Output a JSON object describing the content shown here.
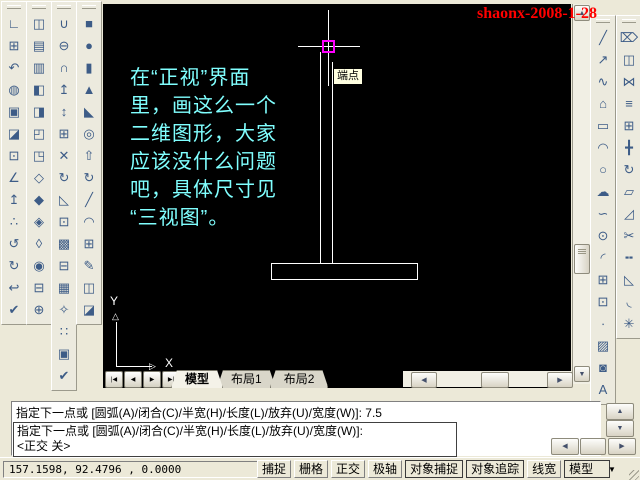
{
  "annotation": {
    "text": "shaonx-2008-1-28",
    "color": "#ff0000"
  },
  "colors": {
    "canvas_bg": "#000000",
    "note_text": "#80ffff",
    "snap_marker": "#ff00ff",
    "tooltip_bg": "#ffffe1",
    "annotation_text": "#ff0000"
  },
  "canvas": {
    "note_lines": [
      "在“正视”界面",
      "里，画这么一个",
      "二维图形，大家",
      "应该没什么问题",
      "吧，具体尺寸见",
      "“三视图”。"
    ],
    "tooltip": "端点",
    "ucs_x": "X",
    "ucs_y": "Y"
  },
  "toolbars": {
    "columns": [
      {
        "id": "tb-l0",
        "name": "ucs-toolbar",
        "icons": [
          {
            "name": "ucs-icon",
            "glyph": "∟"
          },
          {
            "name": "named-ucs-dialog-icon",
            "glyph": "⊞"
          },
          {
            "name": "ucs-previous-icon",
            "glyph": "↶"
          },
          {
            "name": "world-ucs-icon",
            "glyph": "◍"
          },
          {
            "name": "object-ucs-icon",
            "glyph": "▣"
          },
          {
            "name": "face-ucs-icon",
            "glyph": "◪"
          },
          {
            "name": "view-ucs-icon",
            "glyph": "⊡"
          },
          {
            "name": "origin-ucs-icon",
            "glyph": "∠"
          },
          {
            "name": "z-axis-vector-ucs-icon",
            "glyph": "↥"
          },
          {
            "name": "three-point-ucs-icon",
            "glyph": "∴"
          },
          {
            "name": "x-rotate-ucs-icon",
            "glyph": "↺"
          },
          {
            "name": "y-rotate-ucs-icon",
            "glyph": "↻"
          },
          {
            "name": "z-rotate-ucs-icon",
            "glyph": "↩"
          },
          {
            "name": "apply-ucs-icon",
            "glyph": "✔"
          }
        ]
      },
      {
        "id": "tb-l1",
        "name": "view-toolbar",
        "icons": [
          {
            "name": "named-views-icon",
            "glyph": "◫"
          },
          {
            "name": "top-view-icon",
            "glyph": "▤"
          },
          {
            "name": "bottom-view-icon",
            "glyph": "▥"
          },
          {
            "name": "left-view-icon",
            "glyph": "◧"
          },
          {
            "name": "right-view-icon",
            "glyph": "◨"
          },
          {
            "name": "front-view-icon",
            "glyph": "◰"
          },
          {
            "name": "back-view-icon",
            "glyph": "◳"
          },
          {
            "name": "sw-isometric-view-icon",
            "glyph": "◇"
          },
          {
            "name": "se-isometric-view-icon",
            "glyph": "◆"
          },
          {
            "name": "ne-isometric-view-icon",
            "glyph": "◈"
          },
          {
            "name": "nw-isometric-view-icon",
            "glyph": "◊"
          },
          {
            "name": "camera-icon",
            "glyph": "◉"
          },
          {
            "name": "plan-view-icon",
            "glyph": "⊟"
          },
          {
            "name": "ucs-origin-icon",
            "glyph": "⊕"
          }
        ]
      },
      {
        "id": "tb-l2",
        "name": "solids-editing-toolbar",
        "icons": [
          {
            "name": "union-icon",
            "glyph": "∪"
          },
          {
            "name": "subtract-icon",
            "glyph": "⊖"
          },
          {
            "name": "intersect-icon",
            "glyph": "∩"
          },
          {
            "name": "extrude-faces-icon",
            "glyph": "↥"
          },
          {
            "name": "move-faces-icon",
            "glyph": "↕"
          },
          {
            "name": "offset-faces-icon",
            "glyph": "⊞"
          },
          {
            "name": "delete-faces-icon",
            "glyph": "✕"
          },
          {
            "name": "rotate-faces-icon",
            "glyph": "↻"
          },
          {
            "name": "taper-faces-icon",
            "glyph": "◺"
          },
          {
            "name": "copy-faces-icon",
            "glyph": "⊡"
          },
          {
            "name": "color-faces-icon",
            "glyph": "▩"
          },
          {
            "name": "copy-edges-icon",
            "glyph": "⊟"
          },
          {
            "name": "color-edges-icon",
            "glyph": "▦"
          },
          {
            "name": "clean-icon",
            "glyph": "✧"
          },
          {
            "name": "separate-icon",
            "glyph": "∷"
          },
          {
            "name": "shell-icon",
            "glyph": "▣"
          },
          {
            "name": "check-icon",
            "glyph": "✔"
          }
        ]
      },
      {
        "id": "tb-l3",
        "name": "solids-toolbar",
        "icons": [
          {
            "name": "box-icon",
            "glyph": "■"
          },
          {
            "name": "sphere-icon",
            "glyph": "●"
          },
          {
            "name": "cylinder-icon",
            "glyph": "▮"
          },
          {
            "name": "cone-icon",
            "glyph": "▲"
          },
          {
            "name": "wedge-icon",
            "glyph": "◣"
          },
          {
            "name": "torus-icon",
            "glyph": "◎"
          },
          {
            "name": "extrude-icon",
            "glyph": "⇧"
          },
          {
            "name": "revolve-icon",
            "glyph": "↻"
          },
          {
            "name": "slice-icon",
            "glyph": "╱"
          },
          {
            "name": "section-icon",
            "glyph": "◠"
          },
          {
            "name": "interfere-icon",
            "glyph": "⊞"
          },
          {
            "name": "setup-drawing-icon",
            "glyph": "✎"
          },
          {
            "name": "setup-view-icon",
            "glyph": "◫"
          },
          {
            "name": "setup-profile-icon",
            "glyph": "◪"
          }
        ]
      },
      {
        "id": "tb-r0",
        "name": "draw-toolbar",
        "icons": [
          {
            "name": "line-icon",
            "glyph": "╱"
          },
          {
            "name": "construction-line-icon",
            "glyph": "↗"
          },
          {
            "name": "polyline-icon",
            "glyph": "∿"
          },
          {
            "name": "polygon-icon",
            "glyph": "⌂"
          },
          {
            "name": "rectangle-icon",
            "glyph": "▭"
          },
          {
            "name": "arc-icon",
            "glyph": "◠"
          },
          {
            "name": "circle-icon",
            "glyph": "○"
          },
          {
            "name": "revcloud-icon",
            "glyph": "☁"
          },
          {
            "name": "spline-icon",
            "glyph": "∽"
          },
          {
            "name": "ellipse-icon",
            "glyph": "⊙"
          },
          {
            "name": "ellipse-arc-icon",
            "glyph": "◜"
          },
          {
            "name": "insert-block-icon",
            "glyph": "⊞"
          },
          {
            "name": "make-block-icon",
            "glyph": "⊡"
          },
          {
            "name": "point-icon",
            "glyph": "∙"
          },
          {
            "name": "hatch-icon",
            "glyph": "▨"
          },
          {
            "name": "region-icon",
            "glyph": "◙"
          },
          {
            "name": "text-icon",
            "glyph": "A"
          }
        ]
      },
      {
        "id": "tb-r1",
        "name": "modify-toolbar",
        "icons": [
          {
            "name": "erase-icon",
            "glyph": "⌦"
          },
          {
            "name": "copy-icon",
            "glyph": "◫"
          },
          {
            "name": "mirror-icon",
            "glyph": "⋈"
          },
          {
            "name": "offset-icon",
            "glyph": "≡"
          },
          {
            "name": "array-icon",
            "glyph": "⊞"
          },
          {
            "name": "move-icon",
            "glyph": "╋"
          },
          {
            "name": "rotate-icon",
            "glyph": "↻"
          },
          {
            "name": "scale-icon",
            "glyph": "▱"
          },
          {
            "name": "stretch-icon",
            "glyph": "◿"
          },
          {
            "name": "trim-icon",
            "glyph": "✂"
          },
          {
            "name": "break-icon",
            "glyph": "╍"
          },
          {
            "name": "chamfer-icon",
            "glyph": "◺"
          },
          {
            "name": "fillet-icon",
            "glyph": "◟"
          },
          {
            "name": "explode-icon",
            "glyph": "✳"
          }
        ]
      }
    ]
  },
  "tab_strip": {
    "nav": [
      {
        "name": "first-tab-button",
        "glyph": "|◀"
      },
      {
        "name": "prev-tab-button",
        "glyph": "◀"
      },
      {
        "name": "next-tab-button",
        "glyph": "▶"
      },
      {
        "name": "last-tab-button",
        "glyph": "▶|"
      }
    ],
    "tabs": [
      {
        "label": "模型",
        "active": true
      },
      {
        "label": "布局1",
        "active": false
      },
      {
        "label": "布局2",
        "active": false
      }
    ]
  },
  "scroll_icons": {
    "up": "▲",
    "down": "▼",
    "left": "◀",
    "right": "▶"
  },
  "command": {
    "history": "指定下一点或  [圆弧(A)/闭合(C)/半宽(H)/长度(L)/放弃(U)/宽度(W)]: 7.5",
    "prompt": "指定下一点或  [圆弧(A)/闭合(C)/半宽(H)/长度(L)/放弃(U)/宽度(W)]:",
    "mode": "<正交 关>"
  },
  "statusbar": {
    "coordinates": "157.1598, 92.4796 ,  0.0000",
    "toggles": [
      {
        "label": "捕捉",
        "active": false
      },
      {
        "label": "栅格",
        "active": false
      },
      {
        "label": "正交",
        "active": false
      },
      {
        "label": "极轴",
        "active": false
      },
      {
        "label": "对象捕捉",
        "active": true
      },
      {
        "label": "对象追踪",
        "active": true
      },
      {
        "label": "线宽",
        "active": false
      },
      {
        "label": "模型",
        "active": true
      }
    ]
  }
}
